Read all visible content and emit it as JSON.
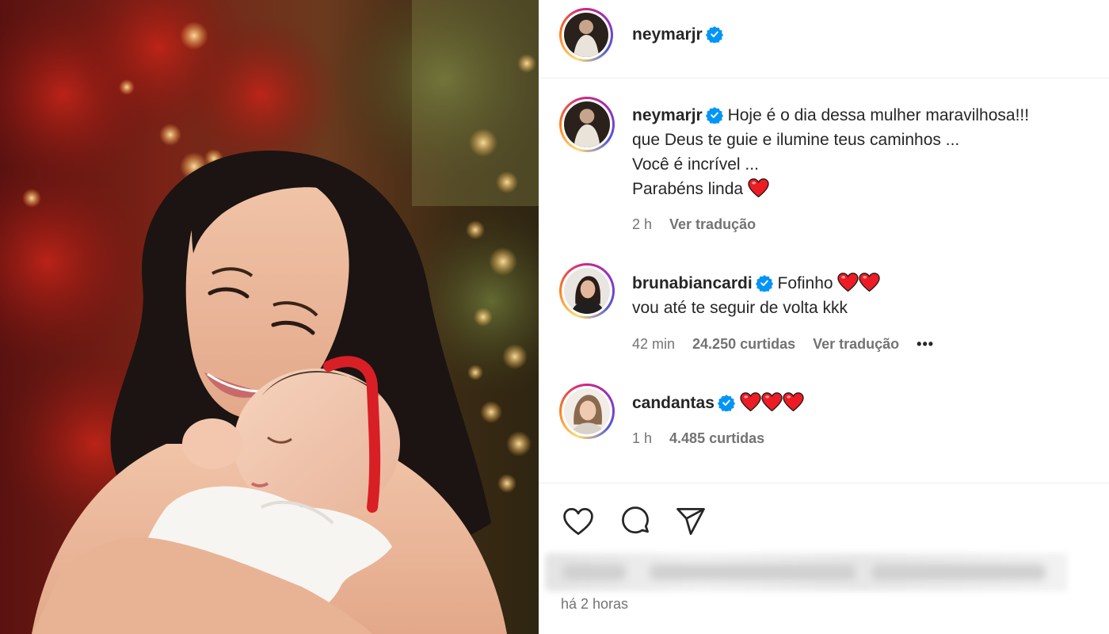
{
  "post": {
    "author": "neymarjr",
    "time_ago": "há 2 horas"
  },
  "caption": {
    "username": "neymarjr",
    "lines": [
      "Hoje é o dia dessa mulher maravilhosa!!!",
      "que Deus te guie e ilumine teus caminhos ...",
      "Você é incrível ...",
      "Parabéns linda"
    ],
    "time": "2 h",
    "translate": "Ver tradução"
  },
  "comments": [
    {
      "username": "brunabiancardi",
      "text_line1": "Fofinho",
      "text_line2": "vou até te seguir de volta kkk",
      "time": "42 min",
      "likes": "24.250 curtidas",
      "translate": "Ver tradução",
      "more": "•••"
    },
    {
      "username": "candantas",
      "time": "1 h",
      "likes": "4.485 curtidas"
    }
  ],
  "colors": {
    "verified": "#0095f6",
    "heart_red": "#ed1c24",
    "meta_gray": "#737373"
  },
  "icons": [
    "verified-badge-icon",
    "heart-emoji-icon",
    "like-icon",
    "comment-icon",
    "share-icon",
    "more-icon"
  ]
}
